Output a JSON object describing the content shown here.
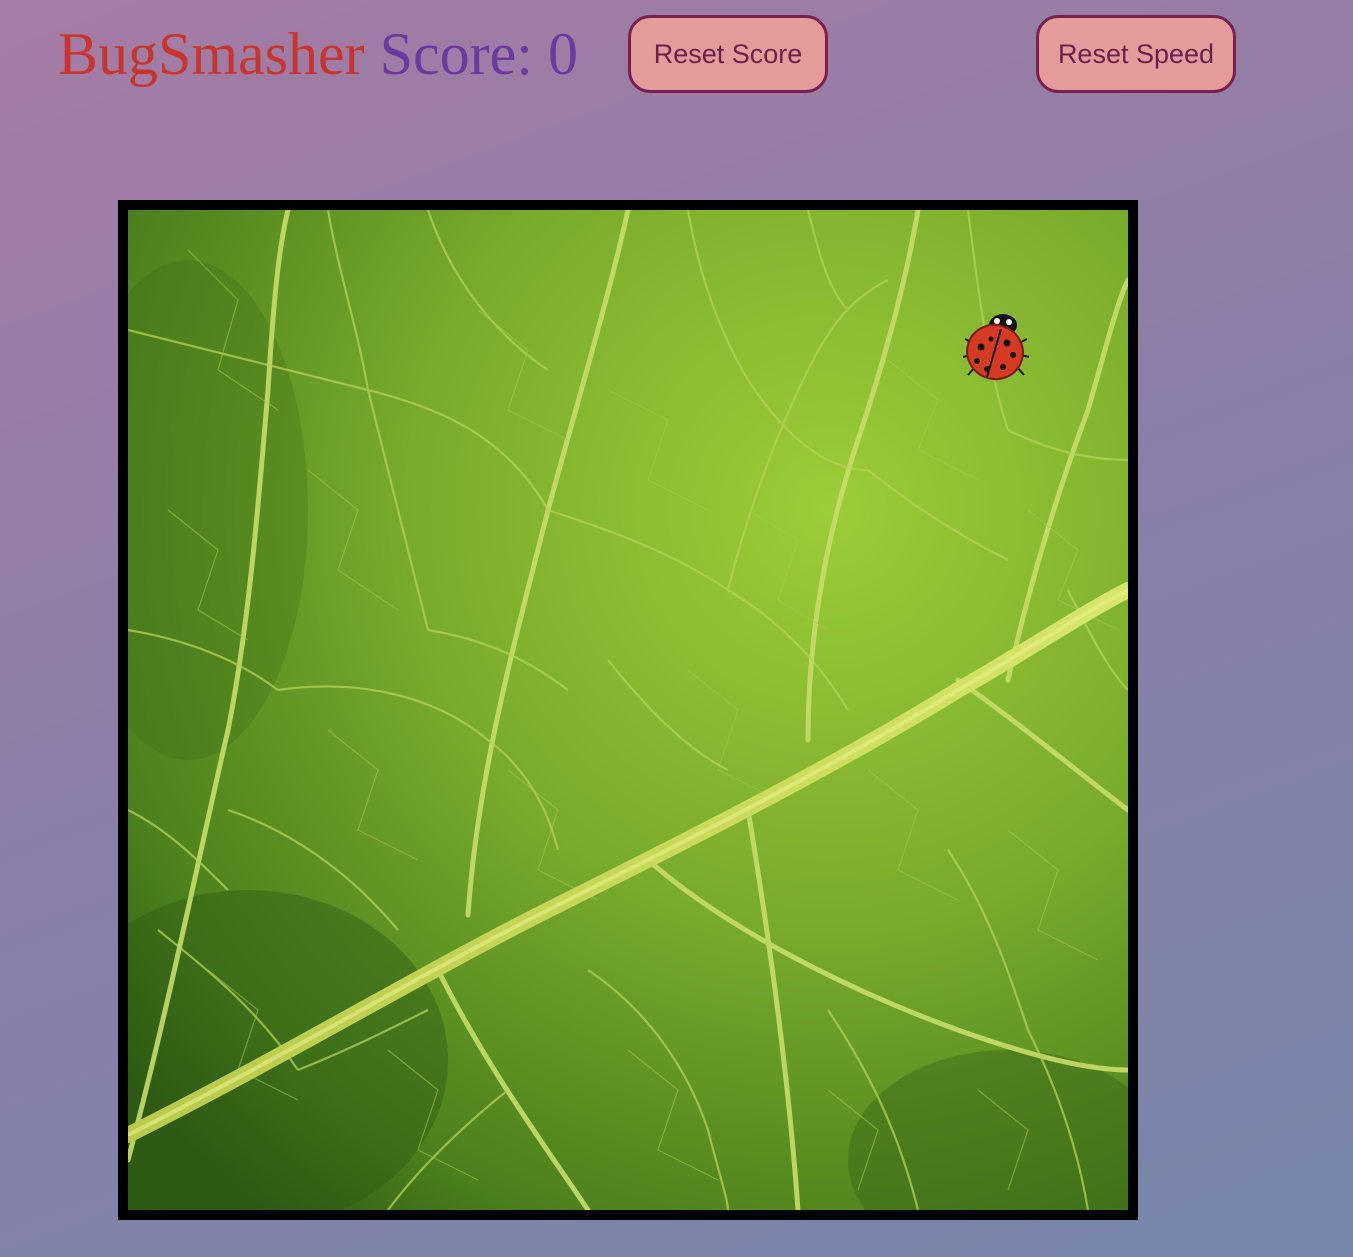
{
  "header": {
    "app_name": "BugSmasher",
    "score_label": "Score:",
    "score_value": "0",
    "reset_score_label": "Reset Score",
    "reset_speed_label": "Reset Speed"
  },
  "game": {
    "background": "leaf",
    "bug": "ladybug"
  },
  "colors": {
    "app_name": "#c8352e",
    "score": "#6a3aa0",
    "button_bg": "#e59b9a",
    "button_border": "#7a1f4f",
    "board_border": "#000000"
  }
}
